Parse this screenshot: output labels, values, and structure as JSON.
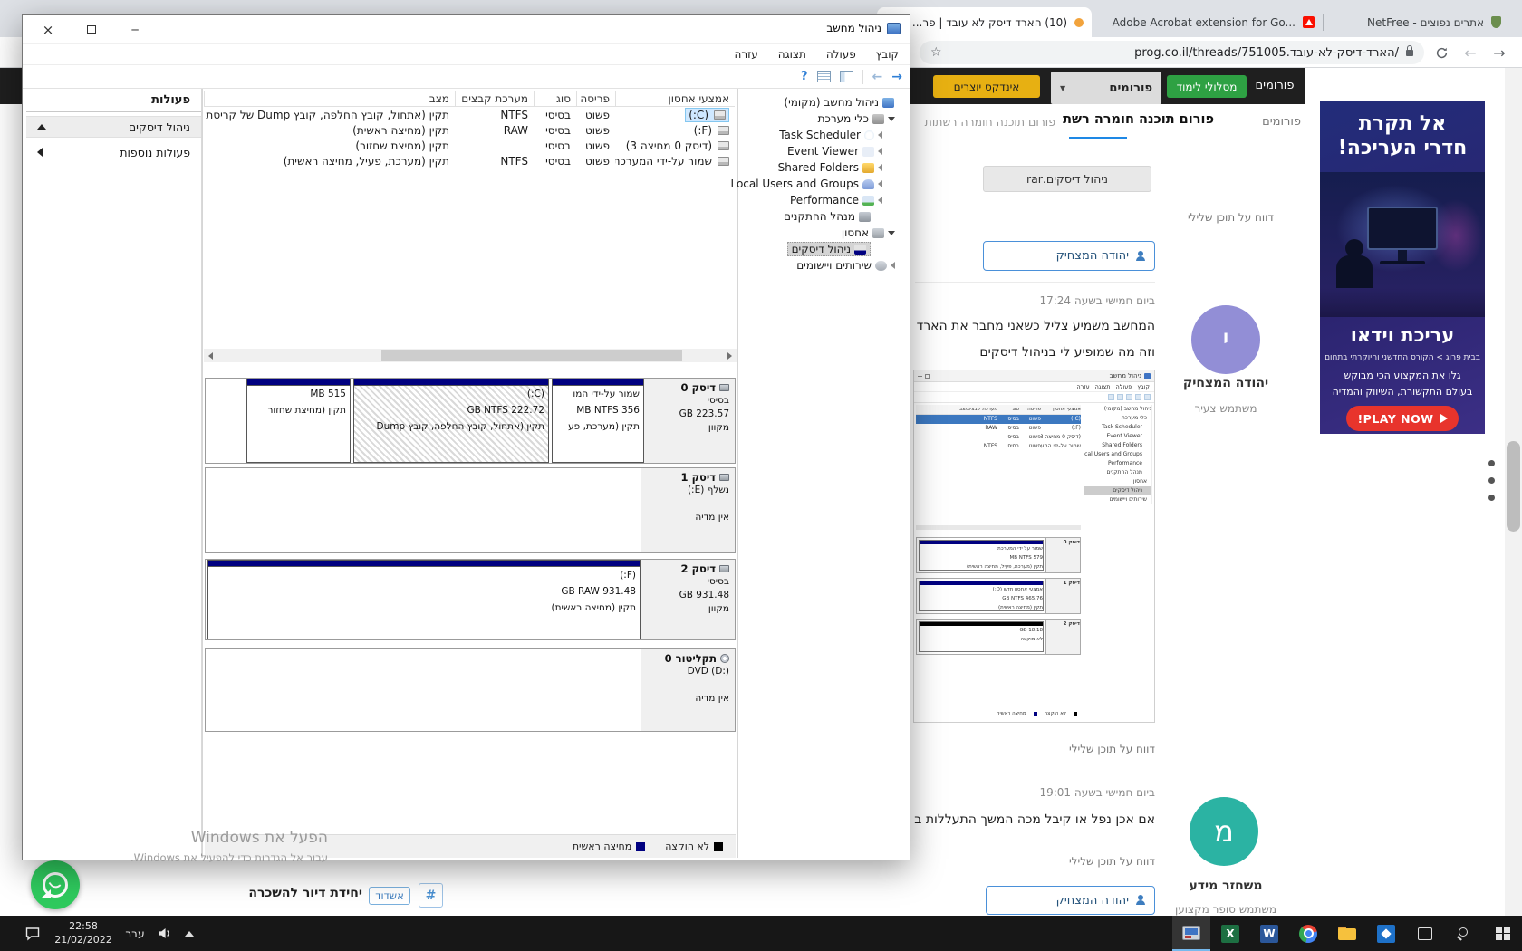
{
  "icons": {
    "close": "×",
    "minimize": "─",
    "back": "→",
    "forward": "←",
    "help": "?",
    "star": "☆",
    "new_tab": "+",
    "hash": "#",
    "caret": "▼",
    "excel_letter": "X",
    "word_letter": "W"
  },
  "colors": {
    "primary_partition_navy": "#000080",
    "unallocated_black": "#000000",
    "selection_blue": "#cce8ff",
    "site_green": "#2ea143",
    "site_yellow": "#e7b012",
    "ad_red": "#e8342c",
    "avatar_purple": "#928ed6",
    "avatar_teal": "#2bb3a3",
    "taskbar_accent": "#76b9ed"
  },
  "browser": {
    "tabs": [
      {
        "title": "(10) הארד דיסק לא עובד | פר..."
      },
      {
        "title": "Adobe Acrobat extension for Go..."
      },
      {
        "title": "NetFree - אתרים נפוצים"
      }
    ],
    "url": "prog.co.il/threads/751005.הארד-דיסק-לא-עובד/"
  },
  "site": {
    "nav": {
      "forums_link": "פורומים",
      "courses_button": "מסלולי לימוד",
      "forums_tab": "פורומים",
      "index_button": "אינדקס יוצרים"
    },
    "breadcrumb": {
      "forums": "פורומים",
      "category": "פורום תוכנה חומרה רשתות",
      "category2": "פורום תוכנה חומרה רשתות"
    },
    "attachment": "ניהול דיסקים.rar",
    "report_link": "דווח על תוכן שלילי",
    "post1": {
      "quote_author": "יהודה המצחיק",
      "time": "ביום חמישי בשעה 17:24",
      "text1": "המחשב משמיע צליל כשאני מחבר את הארד",
      "text2": "וזה מה שמופיע לי בניהול דיסקים"
    },
    "post2": {
      "time": "ביום חמישי בשעה 19:01",
      "text1": "אם אכן נפל או קיבל מכה המשך התעללות ב",
      "quote_author": "יהודה המצחיק"
    },
    "authors": [
      {
        "initial": "י",
        "name": "יהודה המצחיק",
        "role": "משתמש צעיר"
      },
      {
        "initial": "מ",
        "name": "משחזר מידע",
        "role": "משתמש סופר מקצוען"
      }
    ],
    "listing": {
      "title": "יחידת דיור להשכרה",
      "tag": "אשדוד"
    }
  },
  "ad": {
    "headline1": "אל תקרת",
    "headline2": "חדרי העריכה!",
    "title": "עריכת וידאו",
    "subtitle": "בבית פרוג > הקורס החדשני והיוקרתי בתחום",
    "line1": "גלו את המקצוע הכי מבוקש",
    "line2": "בעולם התקשורת, השיווק והמדיה",
    "cta": "PLAY NOW!"
  },
  "cm": {
    "title": "ניהול מחשב",
    "menus": [
      "קובץ",
      "פעולה",
      "תצוגה",
      "עזרה"
    ],
    "actions": {
      "header": "פעולות",
      "item1": "ניהול דיסקים",
      "item2": "פעולות נוספות"
    },
    "tree": [
      {
        "label": "ניהול מחשב (מקומי)"
      },
      {
        "label": "כלי מערכת"
      },
      {
        "label": "Task Scheduler"
      },
      {
        "label": "Event Viewer"
      },
      {
        "label": "Shared Folders"
      },
      {
        "label": "Local Users and Groups"
      },
      {
        "label": "Performance"
      },
      {
        "label": "מנהל ההתקנים"
      },
      {
        "label": "אחסון"
      },
      {
        "label": "ניהול דיסקים"
      },
      {
        "label": "שירותים ויישומים"
      }
    ],
    "table": {
      "headers": [
        "אמצעי אחסון",
        "פריסה",
        "סוג",
        "מערכת קבצים",
        "מצב"
      ],
      "rows": [
        {
          "name": "(C:)",
          "layout": "פשוט",
          "type": "בסיסי",
          "fs": "NTFS",
          "status": "תקין (אתחול, קובץ החלפה, קובץ Dump של קריסת המ"
        },
        {
          "name": "(F:)",
          "layout": "פשוט",
          "type": "בסיסי",
          "fs": "RAW",
          "status": "תקין (מחיצה ראשית)"
        },
        {
          "name": "(דיסק 0 מחיצה 3)",
          "layout": "פשוט",
          "type": "בסיסי",
          "fs": "",
          "status": "תקין (מחיצת שחזור)"
        },
        {
          "name": "שמור על-ידי המערכת",
          "layout": "פשוט",
          "type": "בסיסי",
          "fs": "NTFS",
          "status": "תקין (מערכת, פעיל, מחיצה ראשית)"
        }
      ]
    },
    "disks": [
      {
        "name": "דיסק 0",
        "type": "בסיסי",
        "size": "GB 223.57",
        "status": "מקוון",
        "partitions": [
          {
            "l1": "שמור על-ידי המו",
            "l2": "MB NTFS 356",
            "l3": "תקין (מערכת, פע"
          },
          {
            "l1": "(C:)",
            "l2": "GB NTFS 222.72",
            "l3": "תקין (אתחול, קובץ החלפה, קובץ Dump"
          },
          {
            "l1": "MB 515",
            "l2": "תקין (מחיצת שחזור",
            "l3": ""
          }
        ]
      },
      {
        "name": "דיסק 1",
        "type": "נשלף (E:)",
        "size": "",
        "status": "אין מדיה",
        "partitions": []
      },
      {
        "name": "דיסק 2",
        "type": "בסיסי",
        "size": "GB 931.48",
        "status": "מקוון",
        "partitions": [
          {
            "l1": "(F:)",
            "l2": "GB RAW 931.48",
            "l3": "תקין (מחיצה ראשית)"
          }
        ]
      },
      {
        "name": "תקליטור 0",
        "type": "DVD (D:)",
        "size": "",
        "status": "אין מדיה",
        "partitions": []
      }
    ],
    "legend": [
      {
        "label": "לא הוקצה",
        "color": "#000000"
      },
      {
        "label": "מחיצה ראשית",
        "color": "#000080"
      }
    ]
  },
  "embedded_image": {
    "disk_rows": [
      {
        "label": "שמור על ידי המערכת",
        "info": "MB NTFS 579",
        "status": "תקין (מערכת, פעיל, מחיצה ראשית)"
      },
      {
        "label": "אמצעי אחסון חדש (D:)",
        "info": "GB NTFS 465.76",
        "status": "תקין (מחיצה ראשית)"
      },
      {
        "label": "GB 18.18",
        "info": "לא מוקצה",
        "status": ""
      }
    ],
    "labels": [
      "דיסק 0",
      "דיסק 1",
      "דיסק 2"
    ]
  },
  "watermark": {
    "line1": "הפעל את Windows",
    "line2": "עבור אל הגדרות כדי להפעיל את Windows."
  },
  "taskbar": {
    "time": "22:58",
    "date": "21/02/2022",
    "lang": "עבר"
  }
}
